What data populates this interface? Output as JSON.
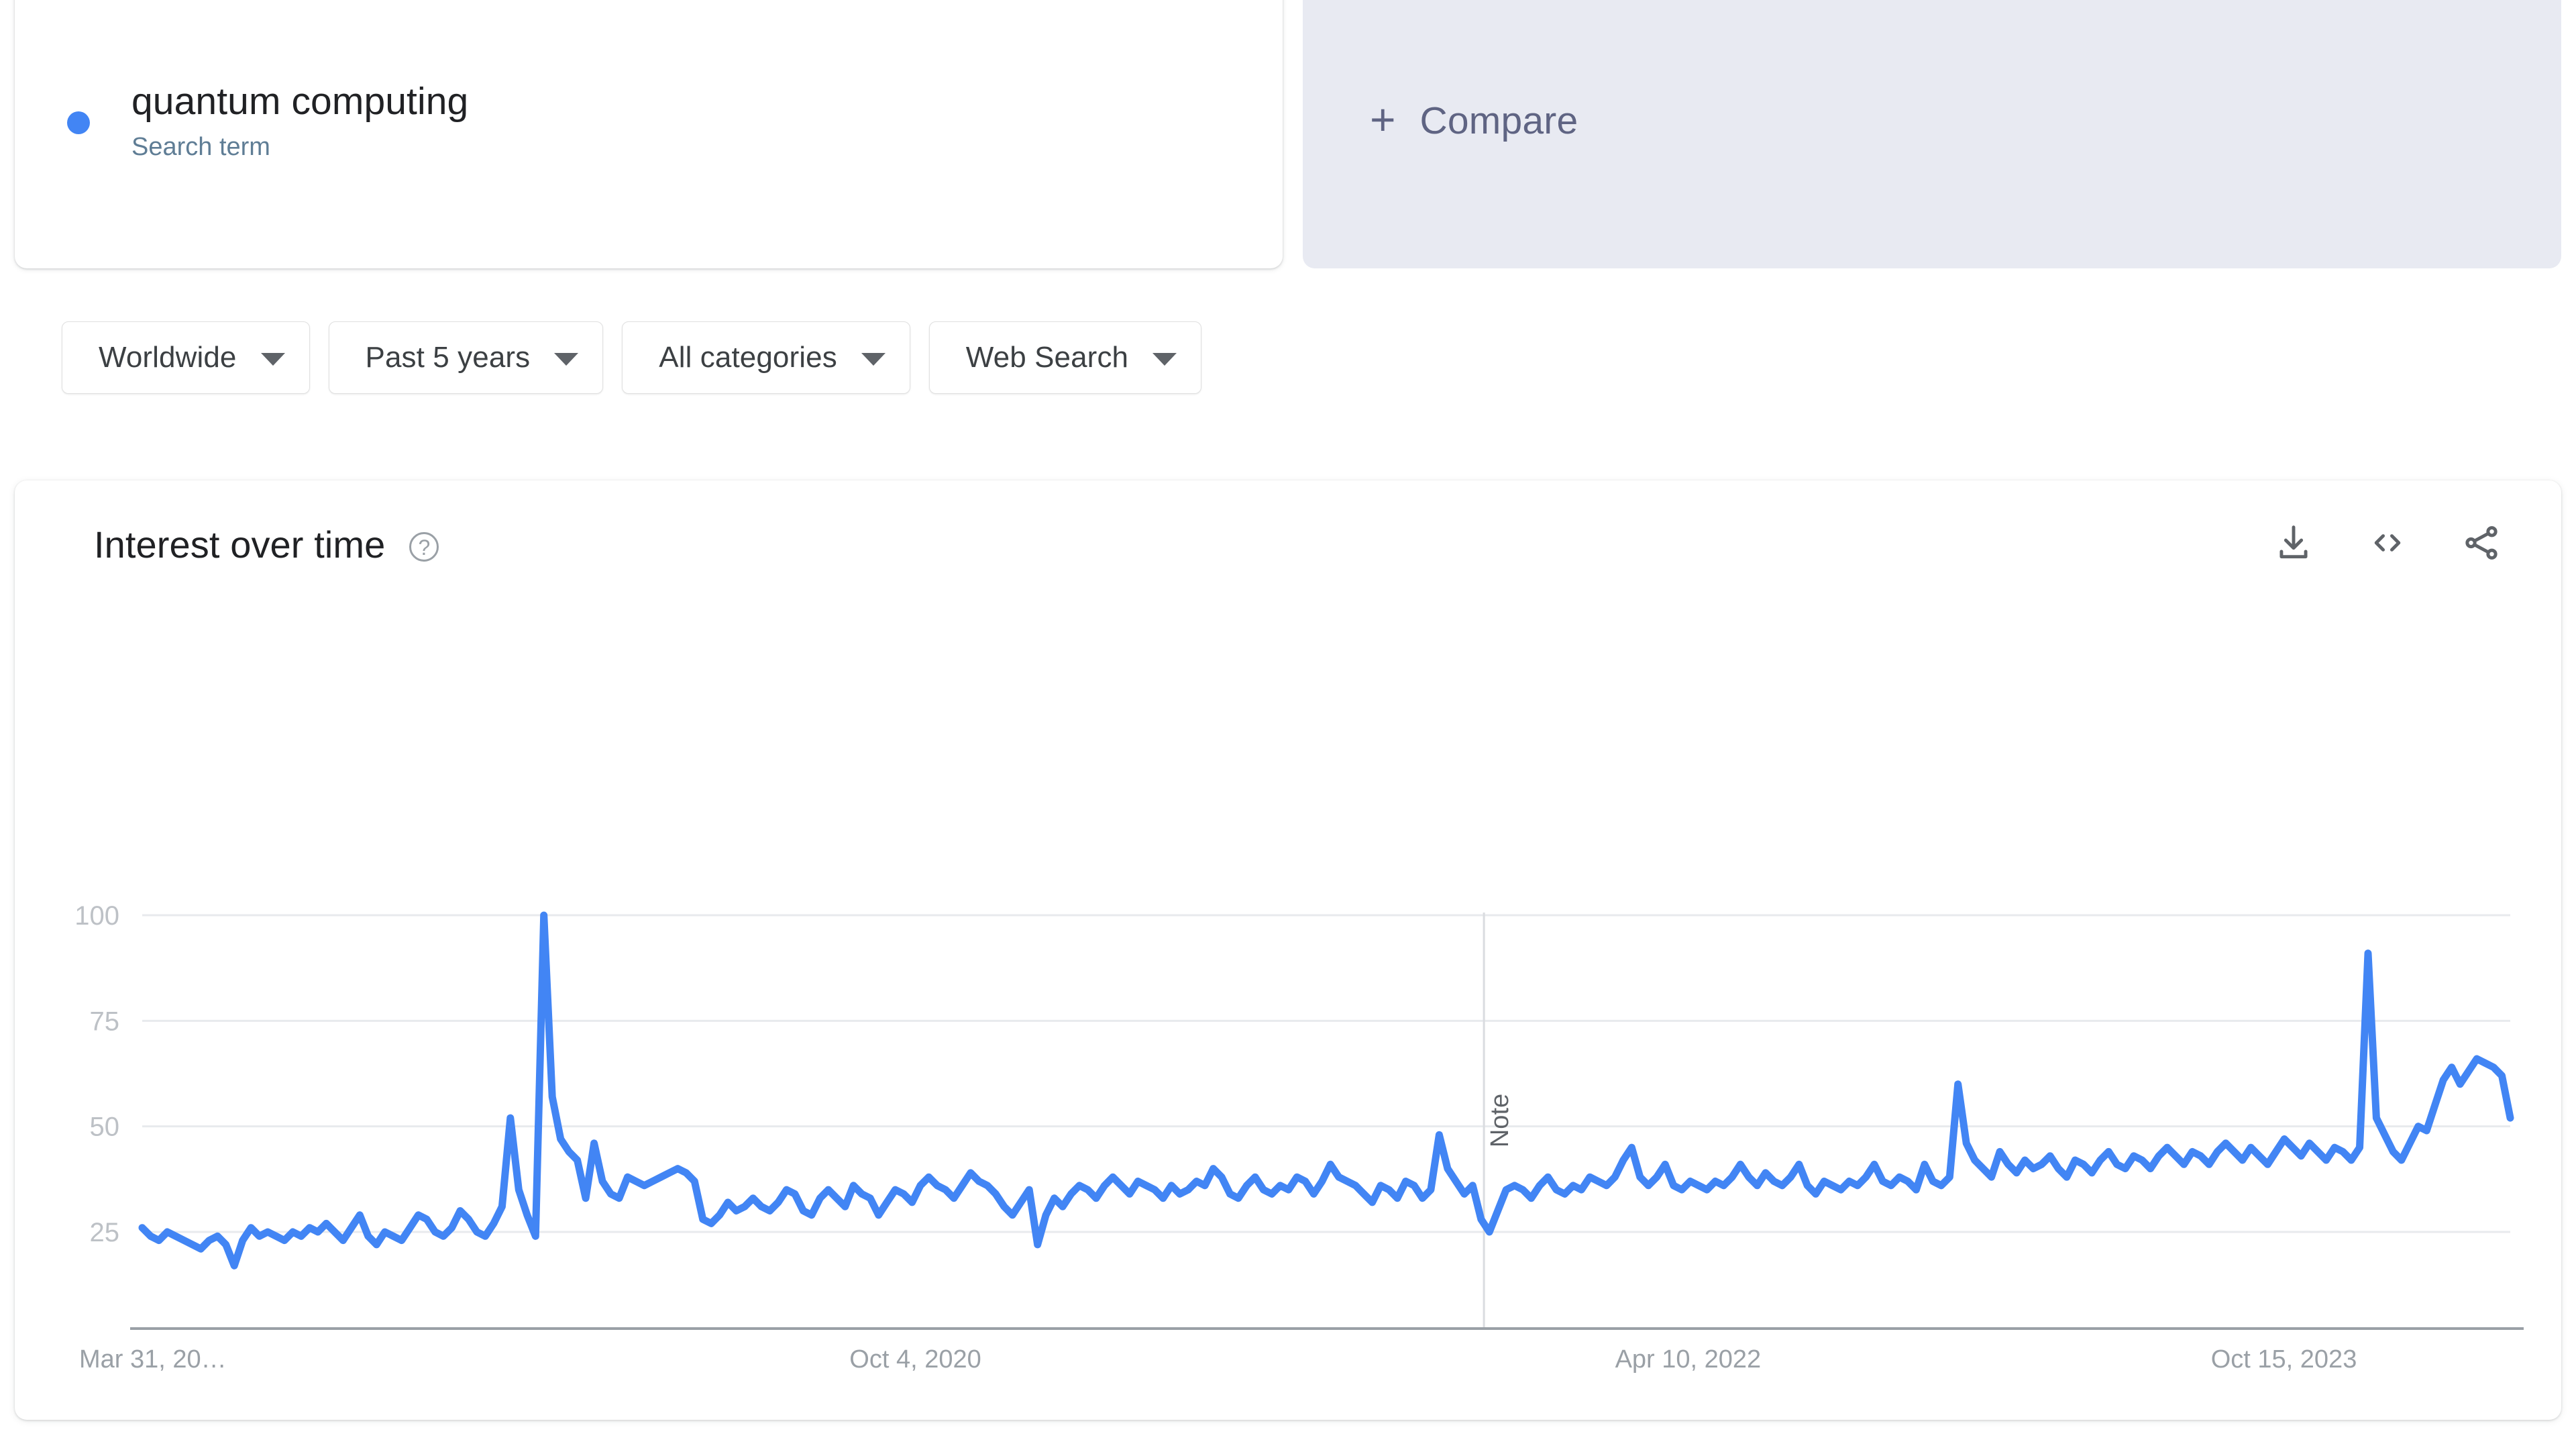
{
  "term_card": {
    "title": "quantum computing",
    "subtitle": "Search term",
    "dot_color": "#4285F4"
  },
  "compare_card": {
    "plus": "+",
    "label": "Compare"
  },
  "filters": [
    {
      "label": "Worldwide"
    },
    {
      "label": "Past 5 years"
    },
    {
      "label": "All categories"
    },
    {
      "label": "Web Search"
    }
  ],
  "chart_card": {
    "title": "Interest over time",
    "help_glyph": "?",
    "actions": [
      {
        "name": "download-icon"
      },
      {
        "name": "embed-icon"
      },
      {
        "name": "share-icon"
      }
    ]
  },
  "chart_data": {
    "type": "line",
    "title": "Interest over time",
    "xlabel": "",
    "ylabel": "",
    "ylim": [
      0,
      100
    ],
    "yticks": [
      25,
      50,
      75,
      100
    ],
    "ytick_labels": [
      "25",
      "50",
      "75",
      "100"
    ],
    "grid": true,
    "legend": "none",
    "line_color": "#4285F4",
    "xtick_labels": [
      "Mar 31, 20…",
      "Oct 4, 2020",
      "Apr 10, 2022",
      "Oct 15, 2023"
    ],
    "xtick_positions": [
      0,
      0.3265,
      0.6528,
      0.9044
    ],
    "annotations": [
      {
        "label": "Note",
        "x_fraction": 0.5666,
        "orientation": "vertical"
      }
    ],
    "series": [
      {
        "name": "quantum computing",
        "values": [
          26,
          24,
          23,
          25,
          24,
          23,
          22,
          21,
          23,
          24,
          22,
          17,
          23,
          26,
          24,
          25,
          24,
          23,
          25,
          24,
          26,
          25,
          27,
          25,
          23,
          26,
          29,
          24,
          22,
          25,
          24,
          23,
          26,
          29,
          28,
          25,
          24,
          26,
          30,
          28,
          25,
          24,
          27,
          31,
          52,
          35,
          29,
          24,
          100,
          57,
          47,
          44,
          42,
          33,
          46,
          37,
          34,
          33,
          38,
          37,
          36,
          37,
          38,
          39,
          40,
          39,
          37,
          28,
          27,
          29,
          32,
          30,
          31,
          33,
          31,
          30,
          32,
          35,
          34,
          30,
          29,
          33,
          35,
          33,
          31,
          36,
          34,
          33,
          29,
          32,
          35,
          34,
          32,
          36,
          38,
          36,
          35,
          33,
          36,
          39,
          37,
          36,
          34,
          31,
          29,
          32,
          35,
          22,
          29,
          33,
          31,
          34,
          36,
          35,
          33,
          36,
          38,
          36,
          34,
          37,
          36,
          35,
          33,
          36,
          34,
          35,
          37,
          36,
          40,
          38,
          34,
          33,
          36,
          38,
          35,
          34,
          36,
          35,
          38,
          37,
          34,
          37,
          41,
          38,
          37,
          36,
          34,
          32,
          36,
          35,
          33,
          37,
          36,
          33,
          35,
          48,
          40,
          37,
          34,
          36,
          28,
          25,
          30,
          35,
          36,
          35,
          33,
          36,
          38,
          35,
          34,
          36,
          35,
          38,
          37,
          36,
          38,
          42,
          45,
          38,
          36,
          38,
          41,
          36,
          35,
          37,
          36,
          35,
          37,
          36,
          38,
          41,
          38,
          36,
          39,
          37,
          36,
          38,
          41,
          36,
          34,
          37,
          36,
          35,
          37,
          36,
          38,
          41,
          37,
          36,
          38,
          37,
          35,
          41,
          37,
          36,
          38,
          60,
          46,
          42,
          40,
          38,
          44,
          41,
          39,
          42,
          40,
          41,
          43,
          40,
          38,
          42,
          41,
          39,
          42,
          44,
          41,
          40,
          43,
          42,
          40,
          43,
          45,
          43,
          41,
          44,
          43,
          41,
          44,
          46,
          44,
          42,
          45,
          43,
          41,
          44,
          47,
          45,
          43,
          46,
          44,
          42,
          45,
          44,
          42,
          45,
          91,
          52,
          48,
          44,
          42,
          46,
          50,
          49,
          55,
          61,
          64,
          60,
          63,
          66,
          65,
          64,
          62,
          52
        ]
      }
    ]
  }
}
